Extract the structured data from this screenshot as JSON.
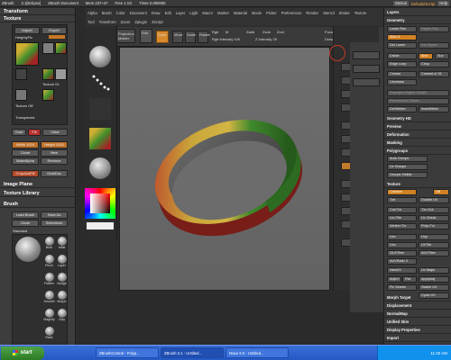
{
  "titlebar": {
    "app": "ZBrush",
    "version": "3.1[Eclipse]",
    "doc": "ZBrush Document",
    "mem": "Mem 237+47",
    "free": "Free 1.1G",
    "timer": "Timer 0.000000",
    "menus": "Menus",
    "default_script": "DefaultZScript",
    "help": "Help"
  },
  "menus": {
    "row1": [
      "Alpha",
      "Brush",
      "Color",
      "Document",
      "Draw",
      "Edit",
      "Layer",
      "Light",
      "Macro",
      "Marker",
      "Material",
      "Movie",
      "Picker",
      "Preferences",
      "Render",
      "Stencil",
      "Stroke",
      "Texture"
    ],
    "row2": [
      "Tool",
      "Transform",
      "Zoom",
      "Zplugin",
      "Zscript"
    ]
  },
  "topbar": {
    "zmapper": "ZMapper",
    "projection": "Projection Master",
    "edit": "Edit",
    "draw": "Draw",
    "move": "Move",
    "scale": "Scale",
    "rotate": "Rotate",
    "rgb": "Rgb",
    "mrgb": "M",
    "zadd": "Zadd",
    "zsub": "Zsub",
    "zcut": "Zcut",
    "rgb_intensity": "Rgb Intensity 100",
    "z_intensity": "Z Intensity 25",
    "focal_shift": "Focal Shift 0",
    "draw_size": "Draw Size 64"
  },
  "left": {
    "transform": "Transform",
    "texture": "Texture",
    "import": "Import",
    "export": "Export",
    "heightmap": "HeightyFix",
    "texture_label": "Texture 01",
    "texture_off": "Texture Off",
    "transparent": "Transparent",
    "grad": "Grad",
    "fill": "Fill",
    "clear": "Clear",
    "width": "Width 1024",
    "height": "Height 1024",
    "clone": "Clone",
    "new": "New",
    "make_alpha": "MakeAlpha",
    "remove": "Remove",
    "crop_fill": "CropAndFill",
    "grab_doc": "GrabDoc",
    "image_plane": "Image Plane",
    "texture_library": "Texture Library",
    "brush": "Brush",
    "load_brush": "Load Brush",
    "save_as": "Save As",
    "clone2": "Clone",
    "select_icon": "SelectIcon",
    "standard": "Standard",
    "brushes": [
      "Standard",
      "Blob",
      "Inflat",
      "Pinch",
      "Layer",
      "Flatten",
      "Nudge",
      "Smooth",
      "Morph",
      "Magnify",
      "Clay",
      "Rake"
    ]
  },
  "rightpanel": {
    "layers": "Layers",
    "geometry": "Geometry",
    "lower_res": "Lower Res",
    "higher_res": "Higher Res",
    "sdiv": "SDiv 5",
    "del_lower": "Del Lower",
    "del_higher": "Del Higher",
    "divide": "Divide",
    "smt": "Smt",
    "suv": "Suv",
    "edge_loop": "Edge Loop",
    "crisp": "Crisp",
    "crease": "Crease",
    "crease_lvl": "CreaseLvl 15",
    "uncrease": "Uncrease",
    "reproject": "Reproject Higher Subdiv",
    "reconstruct": "Reconstruct Subdiv",
    "del_hidden": "DelHidden",
    "insert_mesh": "InsertMesh",
    "geometry_hd": "Geometry HD",
    "preview": "Preview",
    "deformation": "Deformation",
    "masking": "Masking",
    "polygroups": "Polygroups",
    "auto_groups": "Auto Groups",
    "uv_groups": "Uv Groups",
    "groups_visible": "Groups Visible",
    "texture": "Texture",
    "colorize": "Colorize",
    "txtr": "Txtr",
    "off": "Off",
    "double_uv": "Double UV",
    "col_txr": "Col>Txr",
    "txr_col": "Txr>Col",
    "uv_tile": "Uv>Tile",
    "uv_check": "Uv Check",
    "vertex_txr": "Vertex>Txr",
    "poly_txr": "Poly>Txr",
    "uvc": "Uvc",
    "uvp": "Uvp",
    "uvs": "Uvs",
    "uvtile": "UVTile",
    "gui_tiles": "GUVTiles",
    "auv_tiles": "AUVTiles",
    "adaptive": "AUVRatio 3",
    "new_uv": "NewUV",
    "uv_maps": "Uv Maps",
    "adjust": "AdjUV",
    "flat": "Flat",
    "apply_adj": "ApplyAdj",
    "fix_seams": "Fix Seams",
    "switch_uv": "Switch UV",
    "cycle_uv": "Cycle UV",
    "morph_target": "Morph Target",
    "displacement": "Displacement",
    "normal_map": "NormalMap",
    "unified_skin": "Unified Skin",
    "display_props": "Display Properties",
    "import": "Import",
    "export": "Export"
  },
  "taskbar": {
    "start": "start",
    "items": [
      "ZBrushCentral - Polyp...",
      "ZBrush 3.1 - Untitled...",
      "Maxu 6.0 - Untitled..."
    ],
    "clock": "11:20 AM"
  }
}
